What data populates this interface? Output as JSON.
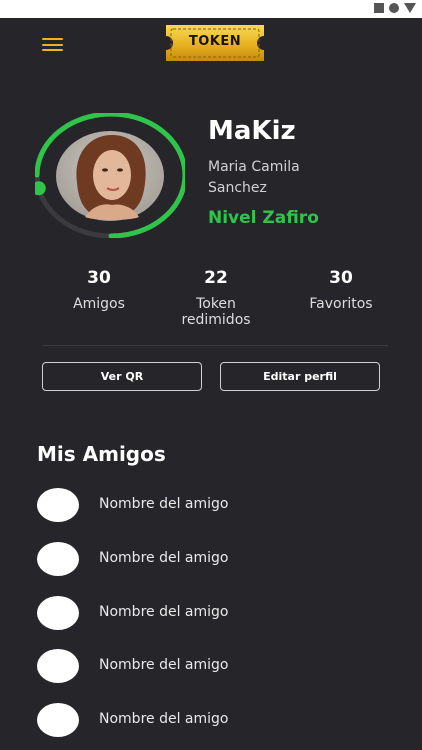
{
  "app": {
    "logo_text": "TOKEN"
  },
  "profile": {
    "username": "MaKiz",
    "fullname": "Maria Camila Sanchez",
    "level": "Nivel Zafiro",
    "progress": 0.75
  },
  "stats": [
    {
      "value": "30",
      "label": "Amigos"
    },
    {
      "value": "22",
      "label": "Token redimidos"
    },
    {
      "value": "30",
      "label": "Favoritos"
    }
  ],
  "buttons": {
    "qr": "Ver QR",
    "edit": "Editar perfil"
  },
  "friends_section": {
    "title": "Mis Amigos",
    "items": [
      {
        "name": "Nombre del amigo"
      },
      {
        "name": "Nombre del amigo"
      },
      {
        "name": "Nombre del amigo"
      },
      {
        "name": "Nombre del amigo"
      },
      {
        "name": "Nombre del amigo"
      }
    ]
  },
  "colors": {
    "background": "#262529",
    "accent_gold": "#f2b21d",
    "level_green": "#2fc44a"
  }
}
